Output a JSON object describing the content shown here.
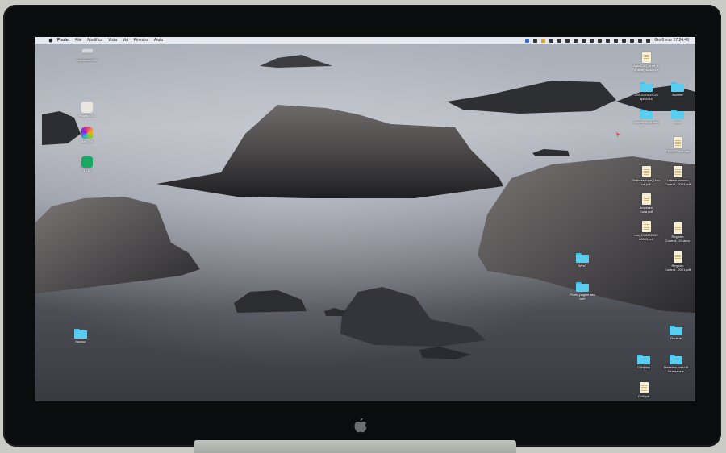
{
  "menubar": {
    "items": [
      "Finder",
      "File",
      "Modifica",
      "Vista",
      "Vai",
      "Finestra",
      "Aiuto"
    ],
    "clock": "Gio 6 mar  17:24:46"
  },
  "desktop_left": [
    {
      "label": "Macintosh HD",
      "icon": "hard-drive-icon"
    },
    {
      "label": "Pages XYZ",
      "icon": "app-icon"
    },
    {
      "label": "BNI_TN",
      "icon": "colorful-app-icon"
    },
    {
      "label": "1618",
      "icon": "green-app-icon"
    },
    {
      "label": "backup",
      "icon": "folder-icon"
    }
  ],
  "desktop_right": [
    {
      "label": "AutoCAD_draft_e\nordinal_stato.pdf",
      "icon": "document-icon"
    },
    {
      "label": "CIG DVRCIS-20\napr 2016",
      "icon": "folder-icon"
    },
    {
      "label": "Bollette",
      "icon": "folder-icon"
    },
    {
      "label": "Vendita su subito",
      "icon": "folder-icon"
    },
    {
      "label": "Sitto",
      "icon": "folder-icon"
    },
    {
      "label": "230420746B.ods",
      "icon": "document-icon"
    },
    {
      "label": "Deliberazione_Unio\nne.pdf",
      "icon": "document-icon"
    },
    {
      "label": "Lettera rinnovo\nContrat...2024.pdf",
      "icon": "document-icon"
    },
    {
      "label": "Brochure\nCorsi.pdf",
      "icon": "document-icon"
    },
    {
      "label": "mic_D00002022\n00000.pdf",
      "icon": "document-icon"
    },
    {
      "label": "Registro\nContrat...23.docx",
      "icon": "document-icon"
    },
    {
      "label": "Registro\nContrat...2021.pdf",
      "icon": "document-icon"
    },
    {
      "label": "Wes3",
      "icon": "folder-icon"
    },
    {
      "label": "Profe -pagine sito\nweb",
      "icon": "folder-icon"
    },
    {
      "label": "Routine",
      "icon": "folder-icon"
    },
    {
      "label": "Coldplay",
      "icon": "folder-icon"
    },
    {
      "label": "Massimo corsi di\nformazione",
      "icon": "folder-icon"
    },
    {
      "label": "Chili.pdf",
      "icon": "document-icon"
    }
  ]
}
